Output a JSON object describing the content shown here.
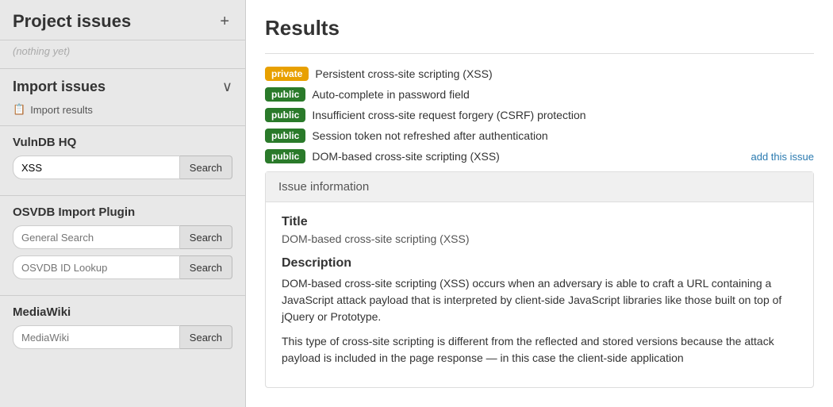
{
  "sidebar": {
    "title": "Project issues",
    "add_button_label": "+",
    "nothing_yet": "(nothing yet)",
    "import_section": {
      "title": "Import issues",
      "chevron": "∨",
      "import_results_label": "Import results",
      "import_results_icon": "📄"
    },
    "vulndb": {
      "title": "VulnDB HQ",
      "search_value": "XSS",
      "search_placeholder": "",
      "search_button": "Search"
    },
    "osvdb": {
      "title": "OSVDB Import Plugin",
      "general_placeholder": "General Search",
      "general_button": "Search",
      "id_placeholder": "OSVDB ID Lookup",
      "id_button": "Search"
    },
    "mediawiki": {
      "title": "MediaWiki",
      "search_placeholder": "MediaWiki",
      "search_button": "Search"
    }
  },
  "main": {
    "results_title": "Results",
    "results": [
      {
        "badge": "private",
        "badge_type": "private",
        "text": "Persistent cross-site scripting (XSS)",
        "add_link": null
      },
      {
        "badge": "public",
        "badge_type": "public",
        "text": "Auto-complete in password field",
        "add_link": null
      },
      {
        "badge": "public",
        "badge_type": "public",
        "text": "Insufficient cross-site request forgery (CSRF) protection",
        "add_link": null
      },
      {
        "badge": "public",
        "badge_type": "public",
        "text": "Session token not refreshed after authentication",
        "add_link": null
      },
      {
        "badge": "public",
        "badge_type": "public",
        "text": "DOM-based cross-site scripting (XSS)",
        "add_link": "add this issue"
      }
    ],
    "issue_info": {
      "header": "Issue information",
      "title_label": "Title",
      "title_value": "DOM-based cross-site scripting (XSS)",
      "desc_label": "Description",
      "desc_text1": "DOM-based cross-site scripting (XSS) occurs when an adversary is able to craft a URL containing a JavaScript attack payload that is interpreted by client-side JavaScript libraries like those built on top of jQuery or Prototype.",
      "desc_text2": "This type of cross-site scripting is different from the reflected and stored versions because the attack payload is included in the page response — in this case the client-side application"
    }
  },
  "colors": {
    "badge_private": "#e8a000",
    "badge_public": "#2a7a2a",
    "add_link": "#2a7ab0"
  }
}
